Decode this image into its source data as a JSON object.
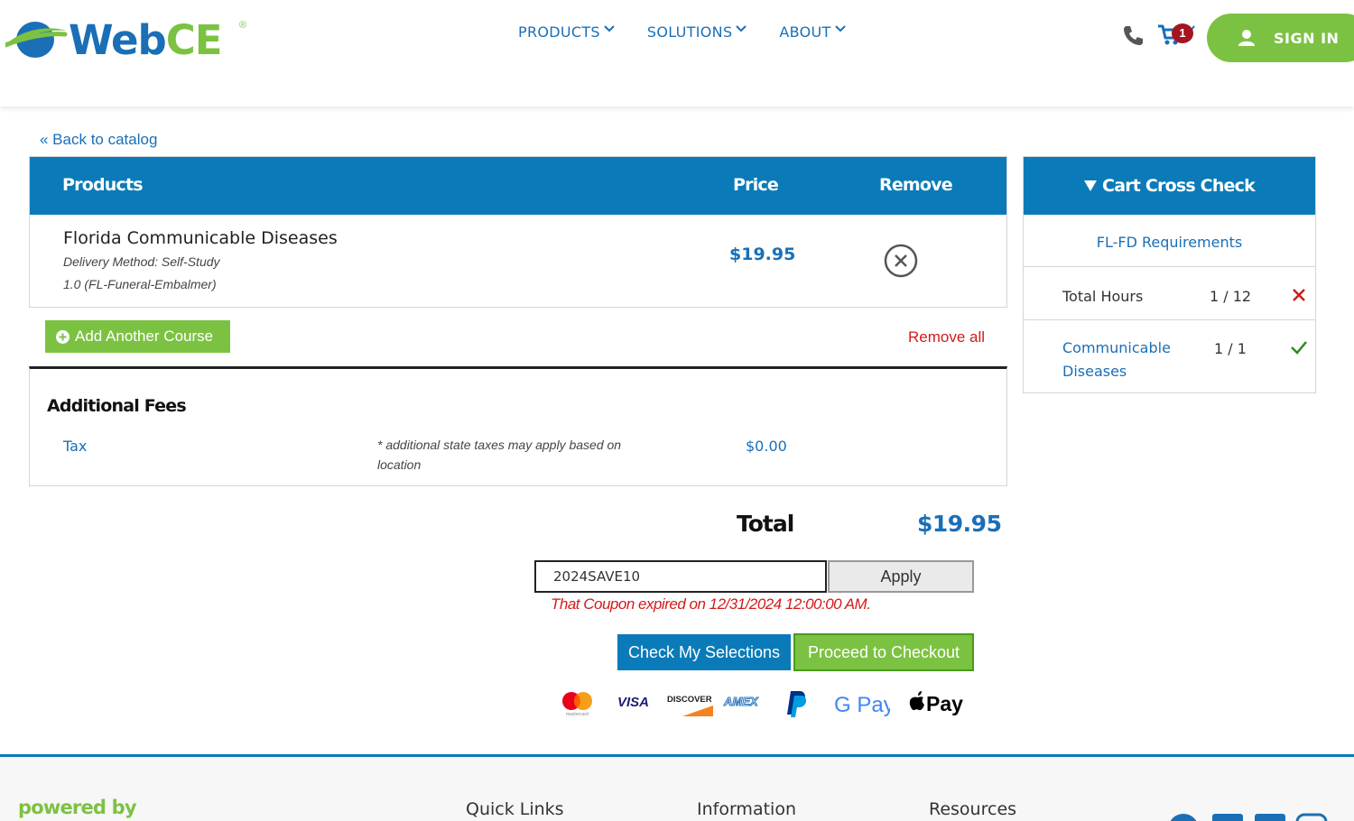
{
  "header": {
    "logo_text_main": "Web",
    "logo_text_accent": "CE",
    "logo_reg": "®",
    "nav": [
      "PRODUCTS",
      "SOLUTIONS",
      "ABOUT"
    ],
    "cart_count": "1",
    "signin_label": "SIGN IN"
  },
  "back_link": "« Back to catalog",
  "products": {
    "headers": {
      "product": "Products",
      "price": "Price",
      "remove": "Remove"
    },
    "item": {
      "title": "Florida Communicable Diseases",
      "delivery": "Delivery Method: Self-Study",
      "credit": "1.0 (FL-Funeral-Embalmer)",
      "price": "$19.95"
    }
  },
  "actions": {
    "add_course": "Add Another Course",
    "remove_all": "Remove all"
  },
  "fees": {
    "title": "Additional Fees",
    "tax_label": "Tax",
    "tax_note": "* additional state taxes may apply based on location",
    "tax_amount": "$0.00"
  },
  "total": {
    "label": "Total",
    "amount": "$19.95"
  },
  "coupon": {
    "value": "2024SAVE10",
    "apply_label": "Apply",
    "error": "That Coupon expired on 12/31/2024 12:00:00 AM."
  },
  "buttons": {
    "check_selections": "Check My Selections",
    "checkout": "Proceed to Checkout"
  },
  "payments": [
    "mastercard",
    "VISA",
    "DISCOVER",
    "AMEX",
    "paypal",
    "G Pay",
    "Pay"
  ],
  "cross_check": {
    "title": "Cart Cross Check",
    "requirements_link": "FL-FD Requirements",
    "rows": [
      {
        "label": "Total Hours",
        "value": "1 / 12",
        "status": "unmet"
      },
      {
        "label_line1": "Communicable",
        "label_line2": "Diseases",
        "value": "1 / 1",
        "status": "met"
      }
    ]
  },
  "footer": {
    "powered_by": "powered by",
    "columns": [
      "Quick Links",
      "Information",
      "Resources"
    ]
  },
  "colors": {
    "brand_blue": "#0a7bb8",
    "link_blue": "#1a6fb7",
    "brand_green": "#7cc242",
    "error_red": "#d11b1b"
  }
}
